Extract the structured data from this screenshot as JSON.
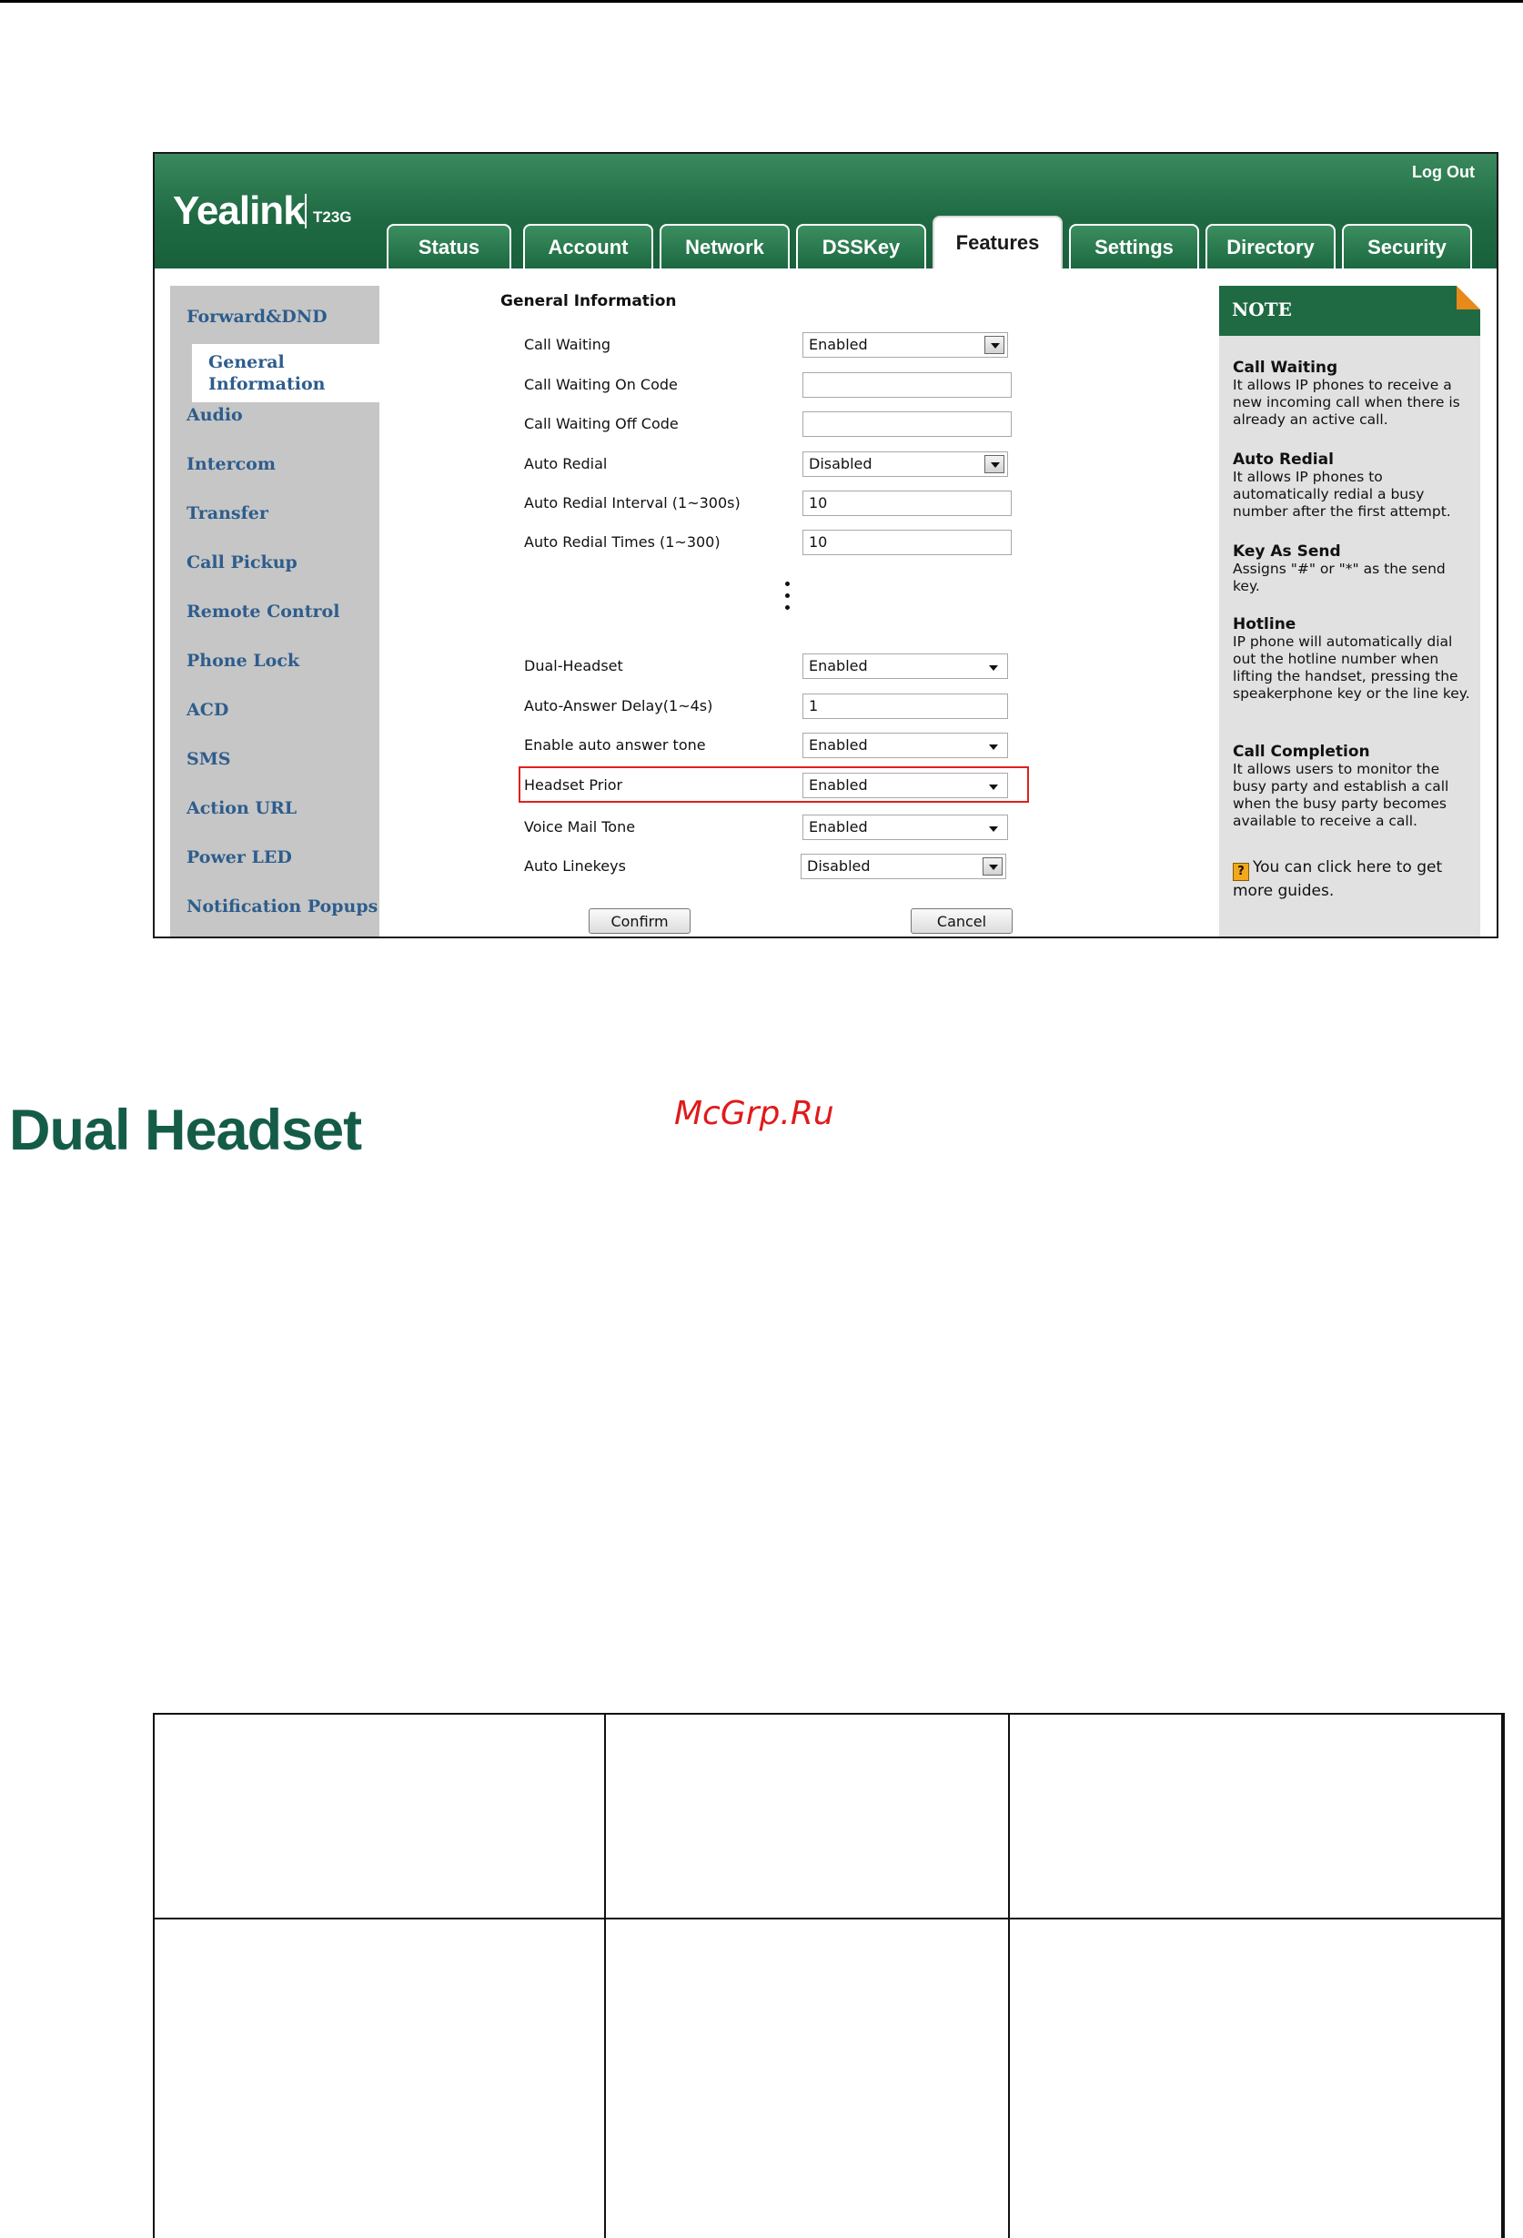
{
  "screenshot": {
    "logo": "Yealink",
    "model": "T23G",
    "logout_label": "Log Out",
    "tabs": [
      "Status",
      "Account",
      "Network",
      "DSSKey",
      "Features",
      "Settings",
      "Directory",
      "Security"
    ],
    "active_tab": "Features",
    "sidebar": [
      "Forward&DND",
      "General Information",
      "Audio",
      "Intercom",
      "Transfer",
      "Call Pickup",
      "Remote Control",
      "Phone Lock",
      "ACD",
      "SMS",
      "Action URL",
      "Power LED",
      "Notification Popups"
    ],
    "active_sidebar": "General Information",
    "section_title": "General Information",
    "fields": [
      {
        "label": "Call Waiting",
        "value": "Enabled",
        "type": "select"
      },
      {
        "label": "Call Waiting On Code",
        "value": "",
        "type": "text"
      },
      {
        "label": "Call Waiting Off Code",
        "value": "",
        "type": "text"
      },
      {
        "label": "Auto Redial",
        "value": "Disabled",
        "type": "select"
      },
      {
        "label": "Auto Redial Interval (1~300s)",
        "value": "10",
        "type": "text"
      },
      {
        "label": "Auto Redial Times (1~300)",
        "value": "10",
        "type": "text"
      },
      {
        "label": "Dual-Headset",
        "value": "Enabled",
        "type": "select"
      },
      {
        "label": "Auto-Answer Delay(1~4s)",
        "value": "1",
        "type": "text"
      },
      {
        "label": "Enable auto answer tone",
        "value": "Enabled",
        "type": "select"
      },
      {
        "label": "Headset Prior",
        "value": "Enabled",
        "type": "select"
      },
      {
        "label": "Voice Mail Tone",
        "value": "Enabled",
        "type": "select"
      },
      {
        "label": "Auto Linekeys",
        "value": "Disabled",
        "type": "select"
      }
    ],
    "confirm_label": "Confirm",
    "cancel_label": "Cancel",
    "note": {
      "title": "NOTE",
      "items": [
        {
          "title": "Call Waiting",
          "text": "It allows IP phones to receive a new incoming call when there is already an active call."
        },
        {
          "title": "Auto Redial",
          "text": "It allows IP phones to automatically redial a busy number after the first attempt."
        },
        {
          "title": "Key As Send",
          "text": "Assigns \"#\" or \"*\" as the send key."
        },
        {
          "title": "Hotline",
          "text": "IP phone will automatically dial out the hotline number when lifting the handset, pressing the speakerphone key or the line key."
        },
        {
          "title": "Call Completion",
          "text": "It allows users to monitor the busy party and establish a call when the busy party becomes available to receive a call."
        }
      ],
      "guide_icon": "?",
      "guide_text": "You can click here to get more guides."
    }
  },
  "document": {
    "heading": "Dual Headset",
    "watermark": "McGrp.Ru"
  }
}
